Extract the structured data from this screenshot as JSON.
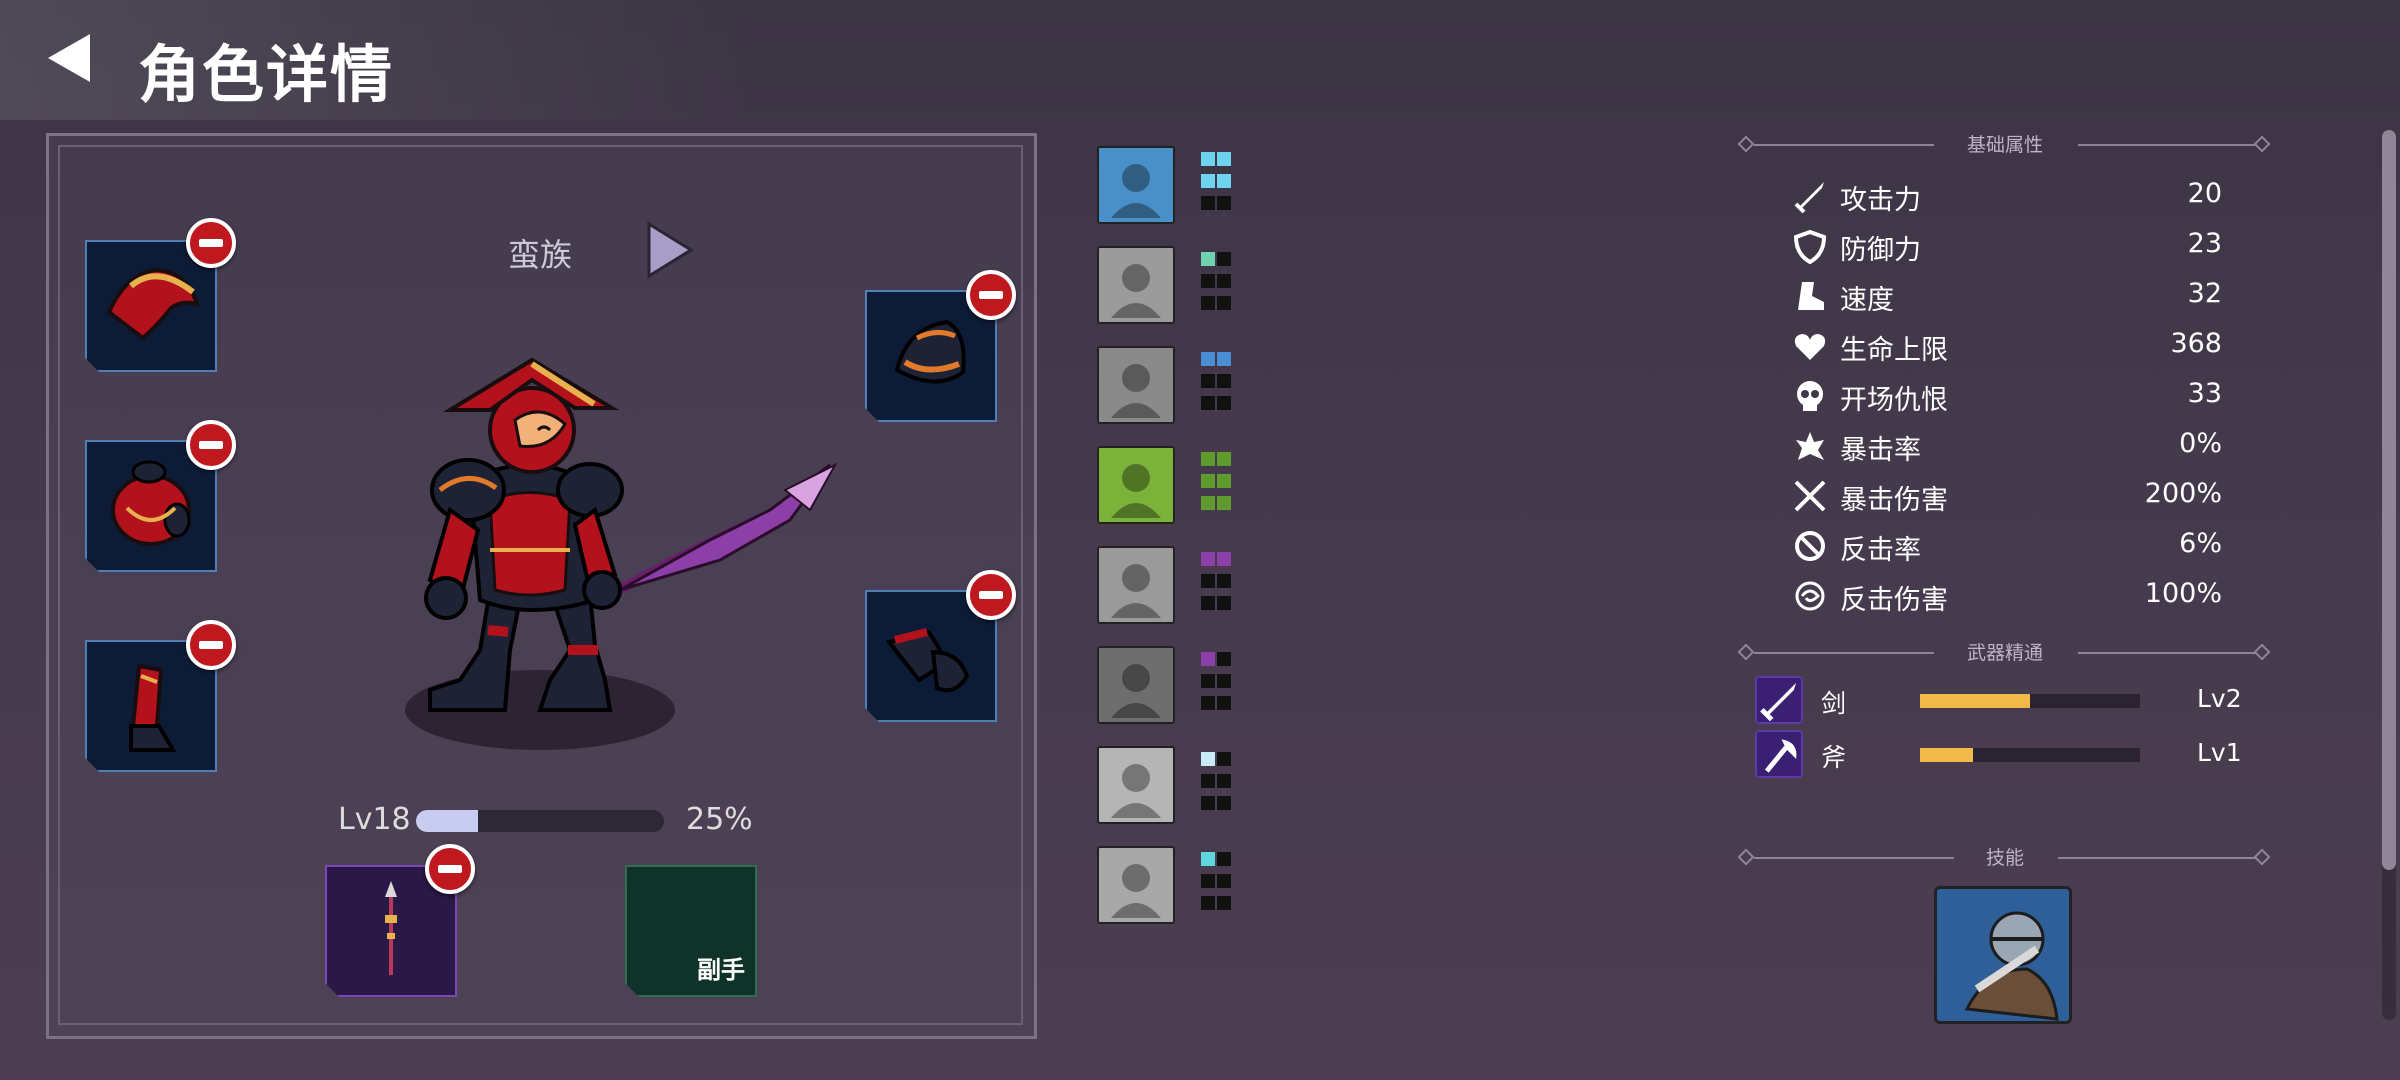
{
  "header": {
    "title": "角色详情"
  },
  "character": {
    "race": "蛮族",
    "level_label": "Lv18",
    "xp_progress": 0.25,
    "xp_percent_text": "25%",
    "offhand_label": "副手"
  },
  "traits": [
    {
      "icon": "warrior-portrait-icon",
      "pips": 4,
      "color": "#6fd3f0"
    },
    {
      "icon": "eye-icon",
      "pips": 1,
      "color": "#6fd3b0"
    },
    {
      "icon": "beast-icon",
      "pips": 2,
      "color": "#4a8fd4"
    },
    {
      "icon": "horned-helmet-icon",
      "pips": 6,
      "color": "#5f9a2c"
    },
    {
      "icon": "stone-face-icon",
      "pips": 2,
      "color": "#8d3fa8"
    },
    {
      "icon": "hooded-figure-icon",
      "pips": 1,
      "color": "#8d3fa8"
    },
    {
      "icon": "winged-emblem-icon",
      "pips": 1,
      "color": "#c9ecf6"
    },
    {
      "icon": "ghost-icon",
      "pips": 1,
      "color": "#5fd6de"
    }
  ],
  "stats": {
    "section_title": "基础属性",
    "items": [
      {
        "icon": "sword-icon",
        "label": "攻击力",
        "value": "20"
      },
      {
        "icon": "shield-icon",
        "label": "防御力",
        "value": "23"
      },
      {
        "icon": "boot-icon",
        "label": "速度",
        "value": "32"
      },
      {
        "icon": "heart-icon",
        "label": "生命上限",
        "value": "368"
      },
      {
        "icon": "skull-icon",
        "label": "开场仇恨",
        "value": "33"
      },
      {
        "icon": "crit-burst-icon",
        "label": "暴击率",
        "value": "0%"
      },
      {
        "icon": "crossed-swords-icon",
        "label": "暴击伤害",
        "value": "200%"
      },
      {
        "icon": "counter-icon",
        "label": "反击率",
        "value": "6%"
      },
      {
        "icon": "swirl-icon",
        "label": "反击伤害",
        "value": "100%"
      }
    ]
  },
  "mastery": {
    "section_title": "武器精通",
    "items": [
      {
        "icon": "sword-icon",
        "label": "剑",
        "progress": 0.5,
        "level": "Lv2"
      },
      {
        "icon": "axe-icon",
        "label": "斧",
        "progress": 0.24,
        "level": "Lv1"
      }
    ]
  },
  "skills": {
    "section_title": "技能",
    "icon": "knight-skill-icon"
  },
  "colors": {
    "accent_gold": "#f2b84a",
    "remove_red": "#c0181f",
    "slot_blue": "#0d1c36"
  }
}
